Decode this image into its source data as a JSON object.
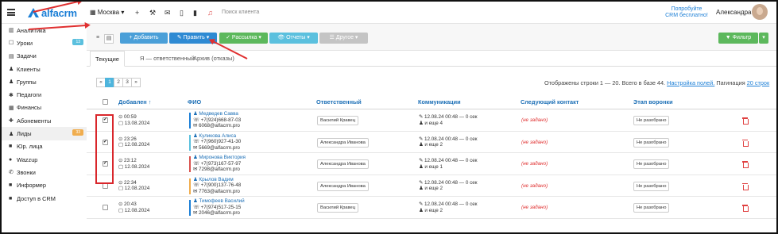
{
  "header": {
    "logo": "alfacrm",
    "branch": "Москва",
    "search_placeholder": "Поиск клиента",
    "trial_line1": "Попробуйте",
    "trial_line2": "CRM бесплатно!",
    "user": "Александра"
  },
  "sidebar": {
    "items": [
      {
        "icon": "chart-icon",
        "glyph": "▥",
        "label": "Аналитика"
      },
      {
        "icon": "lessons-icon",
        "glyph": "☐",
        "label": "Уроки",
        "badge": "13",
        "badge_color": "#5bc0de"
      },
      {
        "icon": "tasks-icon",
        "glyph": "▤",
        "label": "Задачи"
      },
      {
        "icon": "clients-icon",
        "glyph": "♟",
        "label": "Клиенты"
      },
      {
        "icon": "groups-icon",
        "glyph": "♟",
        "label": "Группы"
      },
      {
        "icon": "teachers-icon",
        "glyph": "✱",
        "label": "Педагоги"
      },
      {
        "icon": "finance-icon",
        "glyph": "▦",
        "label": "Финансы"
      },
      {
        "icon": "subscriptions-icon",
        "glyph": "✚",
        "label": "Абонементы"
      },
      {
        "icon": "leads-icon",
        "glyph": "♟",
        "label": "Лиды",
        "badge": "33",
        "badge_color": "#f0ad4e"
      },
      {
        "icon": "legal-icon",
        "glyph": "■",
        "label": "Юр. лица"
      },
      {
        "icon": "wazzup-icon",
        "glyph": "●",
        "label": "Wazzup"
      },
      {
        "icon": "calls-icon",
        "glyph": "✆",
        "label": "Звонки"
      },
      {
        "icon": "informer-icon",
        "glyph": "■",
        "label": "Информер"
      },
      {
        "icon": "crm-access-icon",
        "glyph": "■",
        "label": "Доступ в CRM"
      }
    ]
  },
  "toolbar": {
    "add": "+ Добавить",
    "edit": "✎ Править ▾",
    "mailing": "✓ Рассылка ▾",
    "reports": "👁 Отчеты ▾",
    "other": "☰ Другое ▾",
    "filter": "▼ Фильтр"
  },
  "tabs": [
    "Текущие",
    "Я — ответственный",
    "Архив (отказы)"
  ],
  "pager": {
    "prev": "«",
    "pages": [
      "1",
      "2",
      "3"
    ],
    "next": "»"
  },
  "info": {
    "shown": "Отображены строки 1 — 20. Всего в базе 44.",
    "settings": "Настройка полей.",
    "pagination_label": "Пагинация",
    "pagination_value": "20 строк"
  },
  "columns": {
    "added": "Добавлен ↑",
    "fio": "ФИО",
    "responsible": "Ответственный",
    "communications": "Коммуникации",
    "next_contact": "Следующий контакт",
    "stage": "Этап воронки"
  },
  "colors": {
    "accent": "#1c7fd6",
    "green": "#5cb85c",
    "teal": "#5bc0de",
    "grey": "#bbbbbb",
    "red": "#d9262b"
  },
  "rows": [
    {
      "checked": true,
      "time": "⊙ 00:59",
      "date": "▢ 13.08.2024",
      "name": "♟ Медведев Савва",
      "phone": "☏ +7(924)668-87-03",
      "email": "✉ 6068@alfacrm.pro",
      "bar": "#1c7fd6",
      "responsible": "Василий Кравец",
      "comm1": "✎ 12.08.24 00:48 — 0 сек",
      "comm2": "♟ и еще 4",
      "next": "(не задано)",
      "stage": "Не разобрано"
    },
    {
      "checked": true,
      "time": "⊙ 23:26",
      "date": "▢ 12.08.2024",
      "name": "♟ Куликова Алиса",
      "phone": "☏ +7(960)927-41-30",
      "email": "✉ 5669@alfacrm.pro",
      "bar": "#5bc0de",
      "responsible": "Александра Иванова",
      "comm1": "✎ 12.08.24 00:48 — 0 сек",
      "comm2": "♟ и еще 2",
      "next": "(не задано)",
      "stage": "Не разобрано"
    },
    {
      "checked": true,
      "time": "⊙ 23:12",
      "date": "▢ 12.08.2024",
      "name": "♟ Миронова Виктория",
      "phone": "☏ +7(973)167-57-97",
      "email": "✉ 7298@alfacrm.pro",
      "bar": "#d9534f",
      "responsible": "Александра Иванова",
      "comm1": "✎ 12.08.24 00:48 — 0 сек",
      "comm2": "♟ и еще 1",
      "next": "(не задано)",
      "stage": "Не разобрано"
    },
    {
      "checked": false,
      "time": "⊙ 22:34",
      "date": "▢ 12.08.2024",
      "name": "♟ Крылов Вадим",
      "phone": "☏ +7(900)137-76-48",
      "email": "✉ 7763@alfacrm.pro",
      "bar": "#f0ad4e",
      "responsible": "Александра Иванова",
      "comm1": "✎ 12.08.24 00:48 — 0 сек",
      "comm2": "♟ и еще 2",
      "next": "(не задано)",
      "stage": "Не разобрано"
    },
    {
      "checked": false,
      "time": "⊙ 20:43",
      "date": "▢ 12.08.2024",
      "name": "♟ Тимофеев Василий",
      "phone": "☏ +7(974)517-25-15",
      "email": "✉ 2046@alfacrm.pro",
      "bar": "#1c7fd6",
      "responsible": "Василий Кравец",
      "comm1": "✎ 12.08.24 00:48 — 0 сек",
      "comm2": "♟ и еще 2",
      "next": "(не задано)",
      "stage": "Не разобрано"
    }
  ]
}
